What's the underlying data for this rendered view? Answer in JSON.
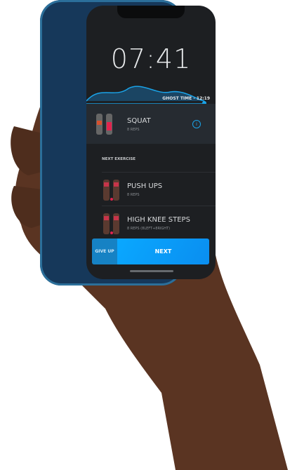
{
  "clock": "07:41",
  "ghost_time": "GHOST TIME - 12:19",
  "current": {
    "name": "SQUAT",
    "reps": "8 REPS"
  },
  "next_label": "NEXT EXERCISE",
  "upcoming": [
    {
      "name": "PUSH UPS",
      "reps": "8 REPS"
    },
    {
      "name": "HIGH KNEE STEPS",
      "reps": "8 REPS (8LEFT+8RIGHT)"
    }
  ],
  "buttons": {
    "give_up": "GIVE UP",
    "next": "NEXT"
  },
  "colors": {
    "accent": "#0a9cf5",
    "give_up": "#1682c4",
    "card": "#262b31",
    "bg": "#1d1f22"
  }
}
